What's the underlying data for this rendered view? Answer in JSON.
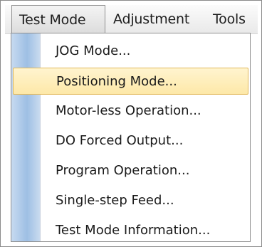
{
  "menubar": {
    "items": [
      {
        "label": "Test Mode"
      },
      {
        "label": "Adjustment"
      },
      {
        "label": "Tools"
      }
    ]
  },
  "dropdown": {
    "items": [
      {
        "label": "JOG Mode..."
      },
      {
        "label": "Positioning Mode..."
      },
      {
        "label": "Motor-less Operation..."
      },
      {
        "label": "DO Forced Output..."
      },
      {
        "label": "Program Operation..."
      },
      {
        "label": "Single-step Feed..."
      },
      {
        "label": "Test Mode Information..."
      }
    ],
    "highlighted_item": "Positioning Mode..."
  },
  "colors": {
    "highlight_fill": "#fde8a8",
    "highlight_border": "#e1b85a",
    "gutter": "#9ebfe4"
  }
}
